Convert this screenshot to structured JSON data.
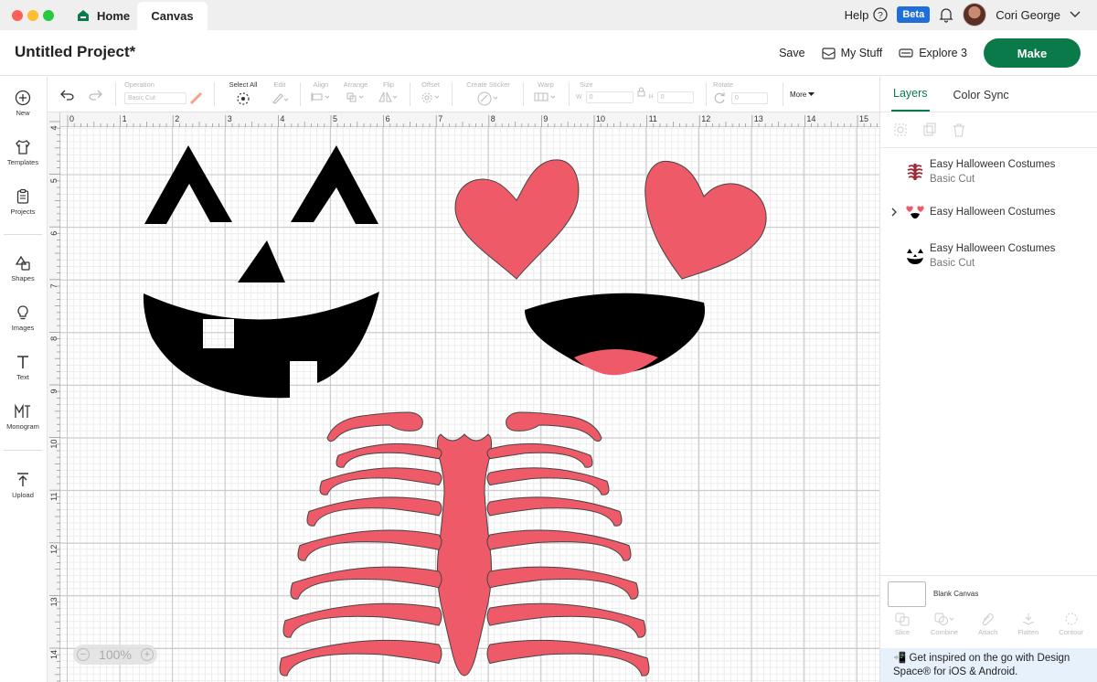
{
  "titlebar": {
    "tab_home": "Home",
    "tab_canvas": "Canvas",
    "help": "Help",
    "beta": "Beta",
    "user_name": "Cori George"
  },
  "header": {
    "project_title": "Untitled Project*",
    "save": "Save",
    "my_stuff": "My Stuff",
    "machine": "Explore 3",
    "make": "Make"
  },
  "toolbar": {
    "operation_label": "Operation",
    "operation_value": "Basic Cut",
    "select_all": "Select All",
    "edit": "Edit",
    "align": "Align",
    "arrange": "Arrange",
    "flip": "Flip",
    "offset": "Offset",
    "create_sticker": "Create Sticker",
    "warp": "Warp",
    "size": "Size",
    "size_w_label": "W",
    "size_w": "0",
    "size_h_label": "H",
    "size_h": "0",
    "rotate": "Rotate",
    "rotate_value": "0",
    "more": "More"
  },
  "sidebar": {
    "items": [
      {
        "label": "New",
        "icon": "plus-circle-icon"
      },
      {
        "label": "Templates",
        "icon": "shirt-icon"
      },
      {
        "label": "Projects",
        "icon": "clipboard-icon"
      },
      {
        "label": "Shapes",
        "icon": "shapes-icon"
      },
      {
        "label": "Images",
        "icon": "lightbulb-icon"
      },
      {
        "label": "Text",
        "icon": "text-icon"
      },
      {
        "label": "Monogram",
        "icon": "monogram-icon"
      },
      {
        "label": "Upload",
        "icon": "upload-icon"
      }
    ]
  },
  "rulers": {
    "top": [
      "0",
      "1",
      "2",
      "3",
      "4",
      "5",
      "6",
      "7",
      "8",
      "9",
      "10",
      "11",
      "12",
      "13",
      "14",
      "15"
    ],
    "left": [
      "4",
      "5",
      "6",
      "7",
      "8",
      "9",
      "10",
      "11",
      "12",
      "13",
      "14"
    ]
  },
  "canvas": {
    "zoom": "100%",
    "pink": "#ee5a67",
    "black": "#000000"
  },
  "panel": {
    "tab_layers": "Layers",
    "tab_color_sync": "Color Sync",
    "layers": [
      {
        "name": "Easy Halloween Costumes",
        "sub": "Basic Cut",
        "icon": "skeleton-thumb-icon"
      },
      {
        "name": "Easy Halloween Costumes",
        "sub": "",
        "icon": "heart-eyes-thumb-icon"
      },
      {
        "name": "Easy Halloween Costumes",
        "sub": "Basic Cut",
        "icon": "pumpkin-face-thumb-icon"
      }
    ],
    "blank_canvas": "Blank Canvas",
    "actions": [
      "Slice",
      "Combine",
      "Attach",
      "Flatten",
      "Contour"
    ],
    "promo": "📲 Get inspired on the go with Design Space® for iOS & Android."
  }
}
